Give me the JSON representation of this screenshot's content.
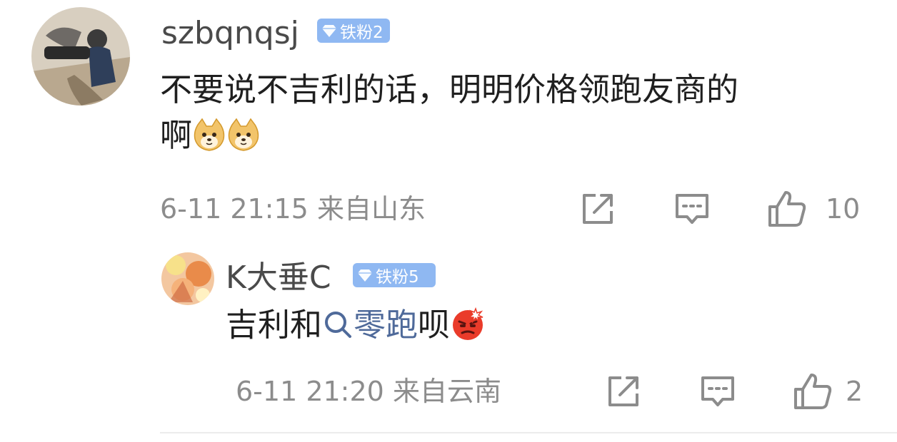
{
  "comment": {
    "username": "szbqnqsj",
    "badge": "铁粉2",
    "text_line1": "不要说不吉利的话，明明价格领跑友商的",
    "text_line2": "啊",
    "emojis": [
      "doge-emoji",
      "doge-emoji"
    ],
    "time": "6-11 21:15",
    "location": "来自山东",
    "like_count": "10"
  },
  "reply": {
    "username": "K大垂C",
    "badge": "铁粉5",
    "text_before": "吉利和",
    "topic": "零跑",
    "text_after": "呗",
    "emoji": "angry-emoji",
    "time": "6-11 21:20",
    "location": "来自云南",
    "like_count": "2"
  },
  "colors": {
    "badge_bg": "#8fb8f2",
    "topic_link": "#4f6a9a",
    "meta_gray": "#8c8c8c"
  }
}
